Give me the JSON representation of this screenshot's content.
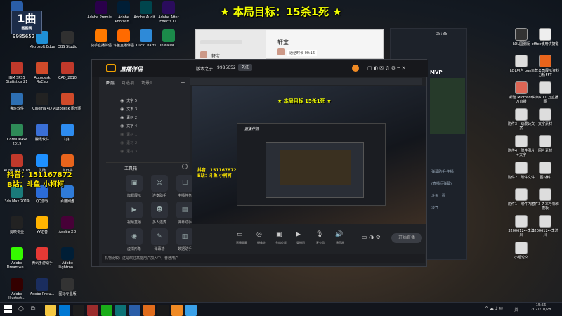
{
  "banner": {
    "text": "★ 本局目标：15杀1死 ★"
  },
  "logo": {
    "main": "1曲",
    "sub": "图图网"
  },
  "overlay": {
    "room_id": "9985652",
    "douyin": "抖音：151167872",
    "bilibili": "B站：斗鱼 小柯柯"
  },
  "desktop_left": [
    {
      "label": "1曲",
      "color": "#2a5ea8"
    },
    {
      "label": "Microsoft Edge",
      "color": "#1f8fd6"
    },
    {
      "label": "OBS Studio",
      "color": "#303030"
    },
    {
      "label": "IBM SPSS Statistics 21",
      "color": "#c0392b"
    },
    {
      "label": "Autodesk ReCap",
      "color": "#d04a2a"
    },
    {
      "label": "CAD_2010",
      "color": "#c0392b"
    },
    {
      "label": "鲁班软件",
      "color": "#2d6fb3"
    },
    {
      "label": "Cinema 4D",
      "color": "#222"
    },
    {
      "label": "Autodesk 图形图",
      "color": "#d04a2a"
    },
    {
      "label": "CorelDRAW 2019",
      "color": "#2e8b57"
    },
    {
      "label": "腾讯软件",
      "color": "#3a6fd6"
    },
    {
      "label": "钉钉",
      "color": "#2d8cf0"
    },
    {
      "label": "AutoCAD 2018",
      "color": "#c0392b"
    },
    {
      "label": "优酷",
      "color": "#1e90ff"
    },
    {
      "label": "向日葵",
      "color": "#e8641c"
    },
    {
      "label": "3ds Max 2019",
      "color": "#1a7a7a"
    },
    {
      "label": "QQ游戏",
      "color": "#2b6cd8"
    },
    {
      "label": "百度网盘",
      "color": "#2f7bd8"
    },
    {
      "label": "剪映专业",
      "color": "#222"
    },
    {
      "label": "YY语音",
      "color": "#ffb300"
    },
    {
      "label": "Adobe XD",
      "color": "#470137"
    },
    {
      "label": "Adobe Dreamwe...",
      "color": "#35fa00"
    },
    {
      "label": "腾讯手游助手",
      "color": "#e53935"
    },
    {
      "label": "Adobe Lightroo...",
      "color": "#001e36"
    },
    {
      "label": "Adobe Illustrat...",
      "color": "#330000"
    },
    {
      "label": "Adobe Prelu...",
      "color": "#1a2d5e"
    },
    {
      "label": "图标专业版",
      "color": "#333"
    }
  ],
  "desktop_top": [
    {
      "label": "Adobe Premie...",
      "color": "#2a004b"
    },
    {
      "label": "Adobe Photosh...",
      "color": "#001e36"
    },
    {
      "label": "Adobe Audit...",
      "color": "#00454d"
    },
    {
      "label": "Adobe After Effects CC",
      "color": "#2a0c5c"
    },
    {
      "label": "快手直播伴侣",
      "color": "#ff7a00"
    },
    {
      "label": "斗鱼直播伴侣",
      "color": "#ff6a00"
    },
    {
      "label": "ClickCharts",
      "color": "#2e8ad8"
    },
    {
      "label": "InstallM...",
      "color": "#1b8a4a"
    }
  ],
  "desktop_right": [
    {
      "label": "LOL国服版",
      "color": "#333"
    },
    {
      "label": "office使用快捷键",
      "color": "#eee"
    },
    {
      "label": "LOL用户 bgm",
      "color": "#ddd"
    },
    {
      "label": "运营公司展示资料分析PPT",
      "color": "#e8641c"
    },
    {
      "label": "新建 Microsoft 万直播",
      "color": "#d65"
    },
    {
      "label": "头条6.11 万直播图",
      "color": "#ddd"
    },
    {
      "label": "附件3：动漫公文案",
      "color": "#ddd"
    },
    {
      "label": "文字素材",
      "color": "#ddd"
    },
    {
      "label": "附件4：附件图片+文字",
      "color": "#ddd"
    },
    {
      "label": "图片素材",
      "color": "#ddd"
    },
    {
      "label": "附件2：附件文件",
      "color": "#ddd"
    },
    {
      "label": "图材料",
      "color": "#ddd"
    },
    {
      "label": "附件1：附件内容",
      "color": "#ddd"
    },
    {
      "label": "附件3-7 本号标准模板",
      "color": "#ddd"
    },
    {
      "label": "32006124-李鸿川",
      "color": "#ddd"
    },
    {
      "label": "32006124-李鸿川",
      "color": "#ddd"
    },
    {
      "label": "小组论文",
      "color": "#ddd"
    }
  ],
  "chat": {
    "title": "轩宝",
    "contact": "轩宝",
    "call_text": "通话时长 00:16",
    "time": "05:35"
  },
  "app": {
    "title": "直播伴侣",
    "nickname": "版本之子",
    "room": "9985652",
    "follow_label": "关注",
    "tabs": [
      "图层",
      "可选项",
      "场景1"
    ],
    "layers": [
      "文字 5",
      "文本 3",
      "素材 2",
      "文字 4",
      "素材 1",
      "素材 2",
      "素材 3"
    ],
    "tools_title": "工具箱",
    "tools": [
      {
        "label": "旗帜展示",
        "icon": "▣"
      },
      {
        "label": "连麦助手",
        "icon": "☺"
      },
      {
        "label": "主播任务",
        "icon": "☐"
      },
      {
        "label": "视频直播",
        "icon": "▶"
      },
      {
        "label": "多人连麦",
        "icon": "☻"
      },
      {
        "label": "弹幕助手",
        "icon": "▤"
      },
      {
        "label": "虚拟形象",
        "icon": "◉"
      },
      {
        "label": "弹幕墙",
        "icon": "✎"
      },
      {
        "label": "数据助手",
        "icon": "▥"
      }
    ],
    "bottom_controls": [
      "直播屏幕",
      "摄像头",
      "多机位屏",
      "录播回",
      "麦克风",
      "扬声器"
    ],
    "start_label": "开始直播",
    "status_text": "礼物比较：还是欢迎高能用户加入中，普通用户",
    "overlay_goal": "★ 本局目标  15杀1死 ★"
  },
  "right_panel": {
    "title": "MVP",
    "items": [
      "弹幕助手-主播",
      "(直播间弹幕)",
      "斗鱼 · 翡",
      "淡气"
    ]
  },
  "taskbar": {
    "time": "15:56",
    "date": "2021/10/28",
    "lang": "英"
  }
}
